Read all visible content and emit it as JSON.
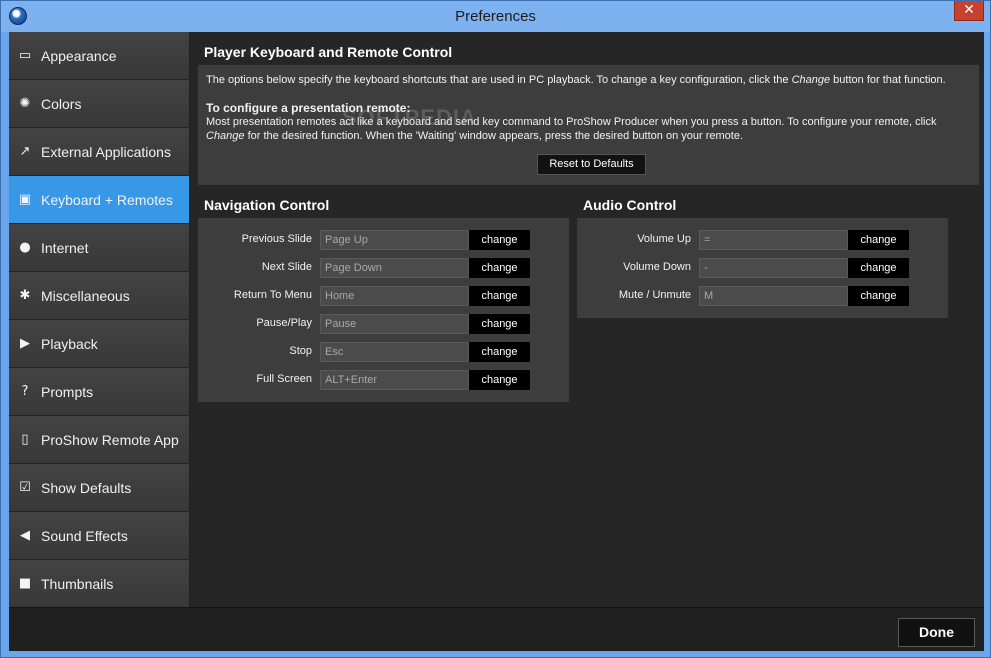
{
  "window": {
    "title": "Preferences",
    "close_glyph": "✕"
  },
  "sidebar": {
    "items": [
      {
        "label": "Appearance",
        "icon": "appearance-icon",
        "glyph": "▭",
        "active": false
      },
      {
        "label": "Colors",
        "icon": "colors-icon",
        "glyph": "✺",
        "active": false
      },
      {
        "label": "External Applications",
        "icon": "external-apps-icon",
        "glyph": "↗",
        "active": false
      },
      {
        "label": "Keyboard + Remotes",
        "icon": "keyboard-icon",
        "glyph": "▣",
        "active": true
      },
      {
        "label": "Internet",
        "icon": "globe-icon",
        "glyph": "●",
        "active": false
      },
      {
        "label": "Miscellaneous",
        "icon": "gear-icon",
        "glyph": "✱",
        "active": false
      },
      {
        "label": "Playback",
        "icon": "play-icon",
        "glyph": "▶",
        "active": false
      },
      {
        "label": "Prompts",
        "icon": "question-icon",
        "glyph": "?",
        "active": false
      },
      {
        "label": "ProShow Remote App",
        "icon": "remote-icon",
        "glyph": "▯",
        "active": false
      },
      {
        "label": "Show Defaults",
        "icon": "checkbox-icon",
        "glyph": "☑",
        "active": false
      },
      {
        "label": "Sound Effects",
        "icon": "speaker-icon",
        "glyph": "◀",
        "active": false
      },
      {
        "label": "Thumbnails",
        "icon": "thumbnail-icon",
        "glyph": "■",
        "active": false
      }
    ]
  },
  "main": {
    "title": "Player Keyboard and Remote Control",
    "watermark": "SOFTPEDIA",
    "info": {
      "intro_pre": "The options below specify the keyboard shortcuts that are used in PC playback. To change a key configuration, click the ",
      "intro_em": "Change",
      "intro_post": " button for that function.",
      "heading": "To configure a presentation remote:",
      "body_pre": "Most presentation remotes act like a keyboard and send key command to ProShow Producer when you press a button. To configure your remote, click ",
      "body_em": "Change",
      "body_post": " for the desired function. When the 'Waiting' window appears, press the desired button on your remote."
    },
    "reset_label": "Reset to Defaults",
    "navigation": {
      "title": "Navigation Control",
      "rows": [
        {
          "label": "Previous Slide",
          "value": "Page Up",
          "button": "change"
        },
        {
          "label": "Next Slide",
          "value": "Page Down",
          "button": "change"
        },
        {
          "label": "Return To Menu",
          "value": "Home",
          "button": "change"
        },
        {
          "label": "Pause/Play",
          "value": "Pause",
          "button": "change"
        },
        {
          "label": "Stop",
          "value": "Esc",
          "button": "change"
        },
        {
          "label": "Full Screen",
          "value": "ALT+Enter",
          "button": "change"
        }
      ]
    },
    "audio": {
      "title": "Audio Control",
      "rows": [
        {
          "label": "Volume Up",
          "value": "=",
          "button": "change"
        },
        {
          "label": "Volume Down",
          "value": "-",
          "button": "change"
        },
        {
          "label": "Mute / Unmute",
          "value": "M",
          "button": "change"
        }
      ]
    }
  },
  "footer": {
    "done_label": "Done"
  },
  "colors": {
    "accent": "#3898e8",
    "panel": "#3d3d3d",
    "background": "#262626",
    "titlebar": "#7db1ef",
    "close": "#c7412f"
  }
}
